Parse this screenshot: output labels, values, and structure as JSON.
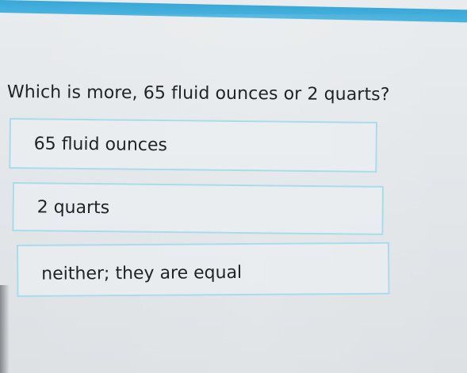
{
  "question": {
    "text": "Which is more, 65 fluid ounces or 2 quarts?"
  },
  "choices": [
    {
      "label": "65 fluid ounces"
    },
    {
      "label": "2 quarts"
    },
    {
      "label": "neither; they are equal"
    }
  ],
  "colors": {
    "header_bar": "#3aa7d6",
    "choice_border": "#a9dcea",
    "background": "#e6e9ec",
    "text": "#1f2326"
  }
}
